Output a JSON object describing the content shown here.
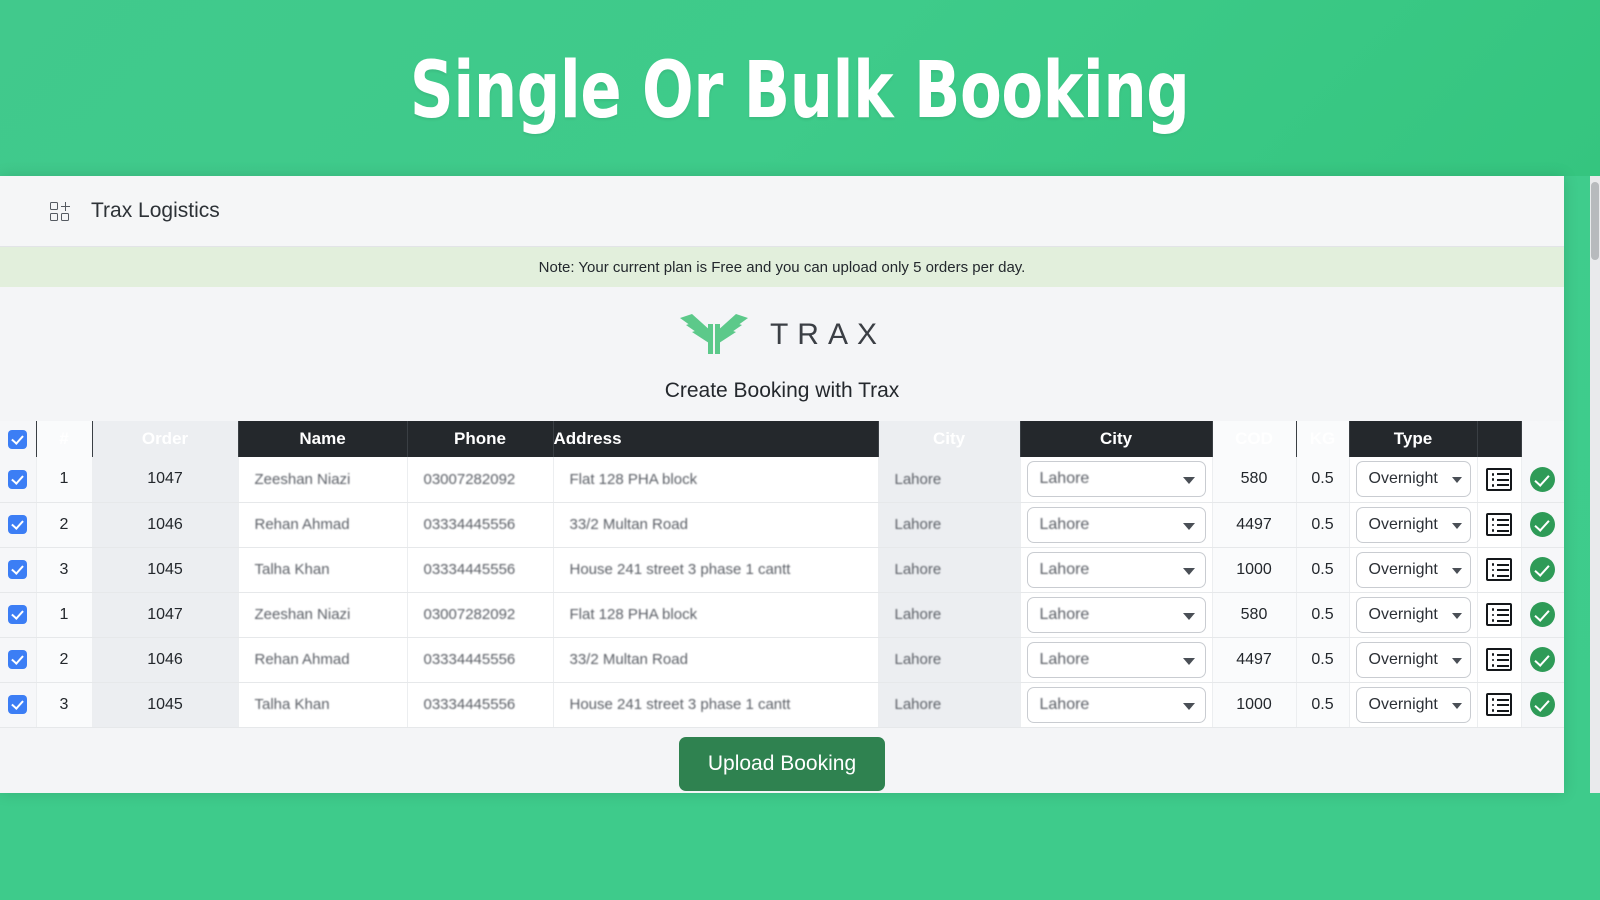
{
  "hero": {
    "title": "Single Or Bulk Booking"
  },
  "appbar": {
    "icon": "grid-plus-icon",
    "title": "Trax Logistics"
  },
  "note": {
    "text": "Note: Your current plan is Free and you can upload only 5 orders per day."
  },
  "brand": {
    "logo_mark": "trax-wing-logo",
    "wordmark": "TRAX",
    "heading": "Create Booking with Trax"
  },
  "table": {
    "select_all_checked": true,
    "columns": [
      "",
      "#",
      "Order",
      "Name",
      "Phone",
      "Address",
      "City",
      "City",
      "COD",
      "KG",
      "Type",
      "",
      ""
    ],
    "rows": [
      {
        "checked": true,
        "num": "1",
        "order": "1047",
        "name": "Zeeshan Niazi",
        "phone": "03007282092",
        "address": "Flat 128 PHA block",
        "city_text": "Lahore",
        "city_select": "Lahore",
        "cod": "580",
        "kg": "0.5",
        "type": "Overnight",
        "detail_icon": "list-icon",
        "status_icon": "check-circle-icon"
      },
      {
        "checked": true,
        "num": "2",
        "order": "1046",
        "name": "Rehan Ahmad",
        "phone": "03334445556",
        "address": "33/2 Multan Road",
        "city_text": "Lahore",
        "city_select": "Lahore",
        "cod": "4497",
        "kg": "0.5",
        "type": "Overnight",
        "detail_icon": "list-icon",
        "status_icon": "check-circle-icon"
      },
      {
        "checked": true,
        "num": "3",
        "order": "1045",
        "name": "Talha Khan",
        "phone": "03334445556",
        "address": "House 241 street 3 phase 1 cantt",
        "city_text": "Lahore",
        "city_select": "Lahore",
        "cod": "1000",
        "kg": "0.5",
        "type": "Overnight",
        "detail_icon": "list-icon",
        "status_icon": "check-circle-icon"
      },
      {
        "checked": true,
        "num": "1",
        "order": "1047",
        "name": "Zeeshan Niazi",
        "phone": "03007282092",
        "address": "Flat 128 PHA block",
        "city_text": "Lahore",
        "city_select": "Lahore",
        "cod": "580",
        "kg": "0.5",
        "type": "Overnight",
        "detail_icon": "list-icon",
        "status_icon": "check-circle-icon"
      },
      {
        "checked": true,
        "num": "2",
        "order": "1046",
        "name": "Rehan Ahmad",
        "phone": "03334445556",
        "address": "33/2 Multan Road",
        "city_text": "Lahore",
        "city_select": "Lahore",
        "cod": "4497",
        "kg": "0.5",
        "type": "Overnight",
        "detail_icon": "list-icon",
        "status_icon": "check-circle-icon"
      },
      {
        "checked": true,
        "num": "3",
        "order": "1045",
        "name": "Talha Khan",
        "phone": "03334445556",
        "address": "House 241 street 3 phase 1 cantt",
        "city_text": "Lahore",
        "city_select": "Lahore",
        "cod": "1000",
        "kg": "0.5",
        "type": "Overnight",
        "detail_icon": "list-icon",
        "status_icon": "check-circle-icon"
      }
    ]
  },
  "footer": {
    "upload_label": "Upload Booking"
  },
  "colors": {
    "hero_green": "#3ecb8a",
    "button_green": "#2f8250",
    "header_dark": "#24282c",
    "checkbox_blue": "#3c7ef5",
    "status_green": "#2e9b57",
    "note_bg": "#e2efdc",
    "logo_green": "#5cc98a"
  }
}
